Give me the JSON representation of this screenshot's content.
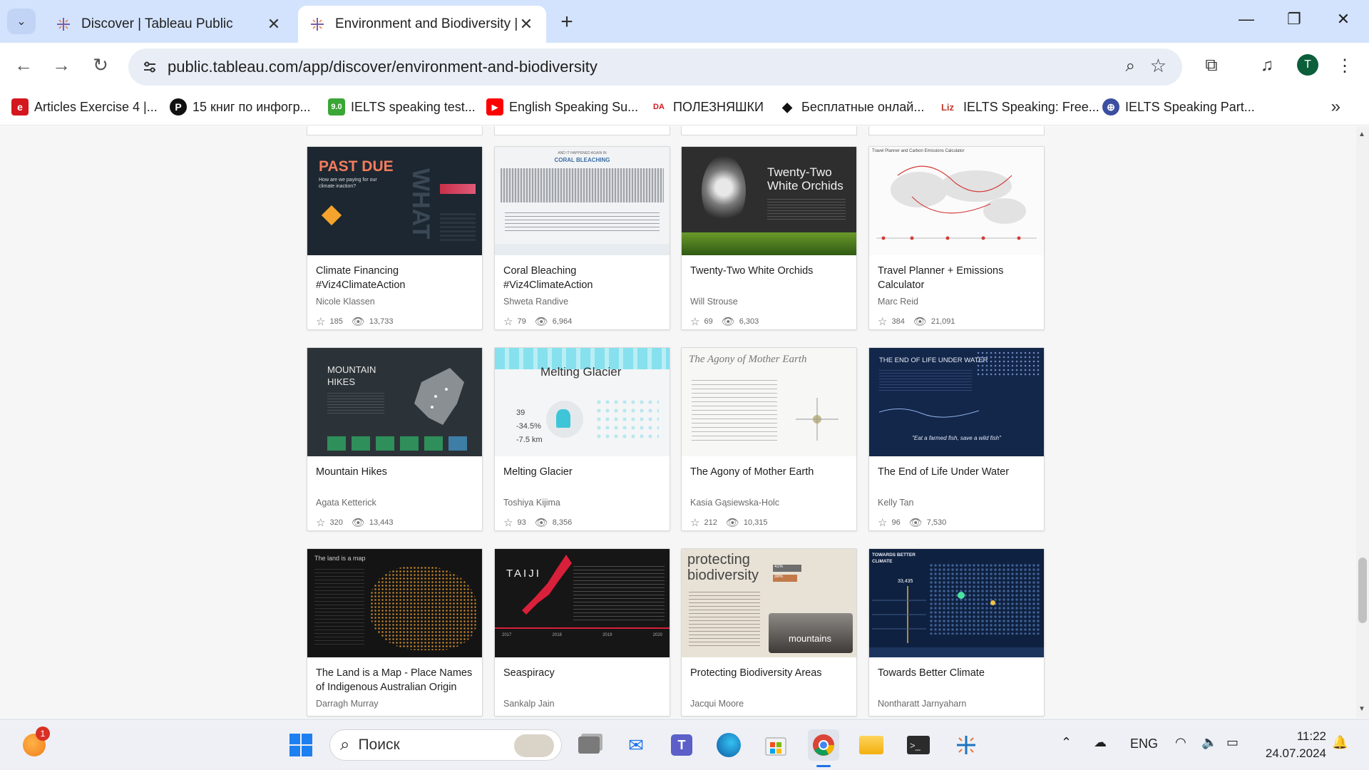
{
  "browser": {
    "tabs": [
      {
        "title": "Discover | Tableau Public",
        "active": false
      },
      {
        "title": "Environment and Biodiversity | T",
        "active": true
      }
    ],
    "url": "public.tableau.com/app/discover/environment-and-biodiversity",
    "profile_initial": "T",
    "bookmarks": [
      {
        "label": "Articles Exercise 4 |...",
        "icon": "e",
        "color": "#d4171e"
      },
      {
        "label": "15 книг по инфогр...",
        "icon": "P",
        "color": "#111111"
      },
      {
        "label": "IELTS speaking test...",
        "icon": "9.0",
        "color": "#3aa635"
      },
      {
        "label": "English Speaking Su...",
        "icon": "▶",
        "color": "#ff0000"
      },
      {
        "label": "ПОЛЕЗНЯШКИ",
        "icon": "DA",
        "color": "#d4171e"
      },
      {
        "label": "Бесплатные онлай...",
        "icon": "◆",
        "color": "#111111"
      },
      {
        "label": "IELTS Speaking: Free...",
        "icon": "Liz",
        "color": "#c0392b"
      },
      {
        "label": "IELTS Speaking Part...",
        "icon": "⊕",
        "color": "#3b4ea0"
      }
    ]
  },
  "cards": [
    {
      "title": "Climate Financing #Viz4ClimateAction",
      "author": "Nicole Klassen",
      "favorites": "185",
      "views": "13,733",
      "thumb_text": "PAST DUE",
      "thumb_sub": "How are we paying for our climate inaction?",
      "thumb_side": "WHAT"
    },
    {
      "title": "Coral Bleaching #Viz4ClimateAction",
      "author": "Shweta Randive",
      "favorites": "79",
      "views": "6,964",
      "thumb_text": "CORAL BLEACHING",
      "thumb_sub": "AND IT HAPPENED AGAIN IN"
    },
    {
      "title": "Twenty-Two White Orchids",
      "author": "Will Strouse",
      "favorites": "69",
      "views": "6,303",
      "thumb_text": "Twenty-Two White Orchids"
    },
    {
      "title": "Travel Planner + Emissions Calculator",
      "author": "Marc Reid",
      "favorites": "384",
      "views": "21,091",
      "thumb_text": "Travel Planner and Carbon Emissions Calculator"
    },
    {
      "title": "Mountain Hikes",
      "author": "Agata Ketterick",
      "favorites": "320",
      "views": "13,443",
      "thumb_text": "MOUNTAIN HIKES"
    },
    {
      "title": "Melting Glacier",
      "author": "Toshiya Kijima",
      "favorites": "93",
      "views": "8,356",
      "thumb_text": "Melting Glacier",
      "thumb_nums": [
        "39",
        "-34.5%",
        "-7.5 km"
      ]
    },
    {
      "title": "The Agony of Mother Earth",
      "author": "Kasia Gąsiewska-Holc",
      "favorites": "212",
      "views": "10,315",
      "thumb_text": "The Agony of Mother Earth"
    },
    {
      "title": "The End of Life Under Water",
      "author": "Kelly Tan",
      "favorites": "96",
      "views": "7,530",
      "thumb_text": "THE END OF LIFE UNDER WATER",
      "thumb_sub": "\"Eat a farmed fish, save a wild fish\""
    },
    {
      "title": "The Land is a Map - Place Names of Indigenous Australian Origin",
      "author": "Darragh Murray",
      "favorites": "",
      "views": "",
      "thumb_text": "The land is a map"
    },
    {
      "title": "Seaspiracy",
      "author": "Sankalp Jain",
      "favorites": "",
      "views": "",
      "thumb_text": "TAIJI",
      "thumb_years": [
        "2017",
        "2018",
        "2019",
        "2020"
      ]
    },
    {
      "title": "Protecting Biodiversity Areas",
      "author": "Jacqui Moore",
      "favorites": "",
      "views": "",
      "thumb_text": "protecting biodiversity",
      "thumb_sub": "mountains",
      "thumb_nums": [
        "41%",
        "38%"
      ]
    },
    {
      "title": "Towards Better Climate",
      "author": "Nontharatt Jarnyaharn",
      "favorites": "",
      "views": "",
      "thumb_text": "TOWARDS BETTER CLIMATE",
      "thumb_nums": [
        "33,435"
      ]
    }
  ],
  "taskbar": {
    "search_placeholder": "Поиск",
    "notification_count": "1",
    "language": "ENG",
    "time": "11:22",
    "date": "24.07.2024"
  }
}
